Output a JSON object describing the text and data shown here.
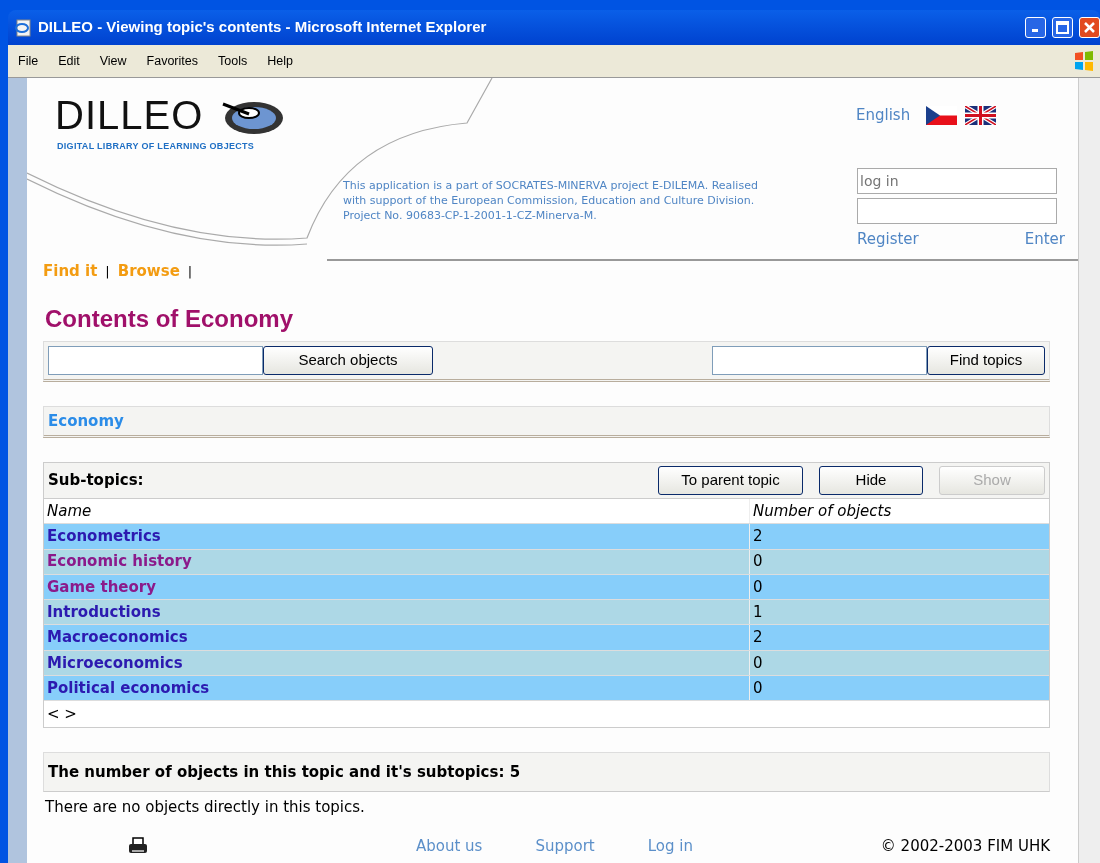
{
  "window": {
    "title": "DILLEO - Viewing topic's contents - Microsoft Internet Explorer"
  },
  "menu": [
    "File",
    "Edit",
    "View",
    "Favorites",
    "Tools",
    "Help"
  ],
  "header": {
    "logo": "DILLEO",
    "tagline": "DIGITAL LIBRARY OF LEARNING OBJECTS",
    "language": "English",
    "info": "This application is a part of SOCRATES-MINERVA project E-DILEMA. Realised with support of the European Commission, Education and Culture Division.",
    "project": "Project No. 90683-CP-1-2001-1-CZ-Minerva-M.",
    "login_placeholder": "log in",
    "register": "Register",
    "enter": "Enter"
  },
  "nav": {
    "items": [
      "Find it",
      "Browse"
    ],
    "separator": "|"
  },
  "heading": "Contents of Economy",
  "search": {
    "objects_button": "Search objects",
    "topics_button": "Find topics"
  },
  "breadcrumb": "Economy",
  "subtopics": {
    "title": "Sub-topics:",
    "buttons": [
      {
        "label": "To parent topic",
        "disabled": false
      },
      {
        "label": "Hide",
        "disabled": false
      },
      {
        "label": "Show",
        "disabled": true
      }
    ],
    "columns": [
      "Name",
      "Number of objects"
    ],
    "rows": [
      {
        "name": "Econometrics",
        "count": "2",
        "visited": false
      },
      {
        "name": "Economic history",
        "count": "0",
        "visited": true
      },
      {
        "name": "Game theory",
        "count": "0",
        "visited": true
      },
      {
        "name": "Introductions",
        "count": "1",
        "visited": false
      },
      {
        "name": "Macroeconomics",
        "count": "2",
        "visited": false
      },
      {
        "name": "Microeconomics",
        "count": "0",
        "visited": false
      },
      {
        "name": "Political economics",
        "count": "0",
        "visited": false
      }
    ],
    "pager": "< >"
  },
  "summary": "The number of objects in this topic and it's subtopics: 5",
  "note": "There are no objects directly in this topics.",
  "footer": {
    "links": [
      "About us",
      "Support",
      "Log in"
    ],
    "copyright": "© 2002-2003 FIM UHK"
  }
}
